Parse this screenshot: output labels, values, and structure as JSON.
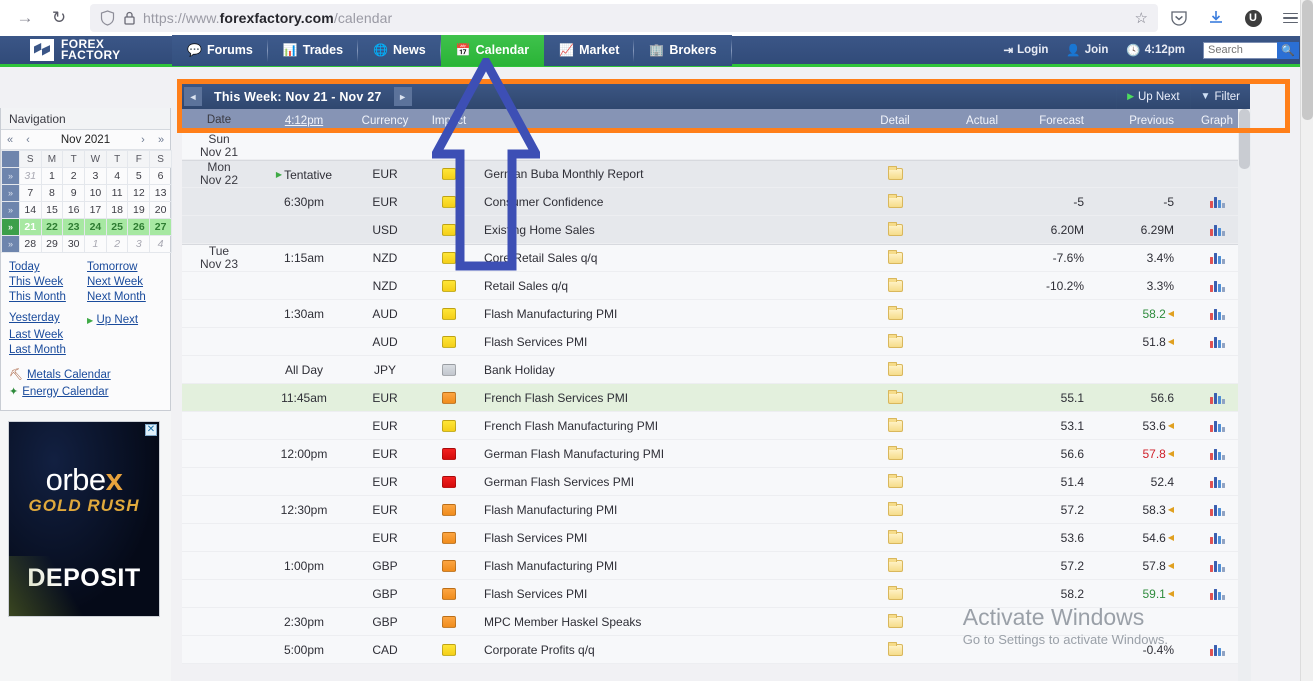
{
  "browser": {
    "url_prefix": "https://www.",
    "url_domain": "forexfactory.com",
    "url_path": "/calendar",
    "forward_icon": "forward-arrow-icon",
    "reload_icon": "reload-icon",
    "shield_icon": "shield-icon",
    "lock_icon": "padlock-icon",
    "star_icon": "bookmark-star-icon",
    "pocket_icon": "pocket-icon",
    "download_icon": "download-icon",
    "ublock_label": "U",
    "menu_icon": "hamburger-menu-icon"
  },
  "site": {
    "logo_line1": "FOREX",
    "logo_line2": "FACTORY",
    "tabs": [
      {
        "label": "Forums",
        "icon": "speech-bubble-icon",
        "glyph": "💬",
        "active": false
      },
      {
        "label": "Trades",
        "icon": "bar-chart-icon",
        "glyph": "📊",
        "active": false
      },
      {
        "label": "News",
        "icon": "globe-icon",
        "glyph": "🌐",
        "active": false
      },
      {
        "label": "Calendar",
        "icon": "calendar-icon",
        "glyph": "📅",
        "active": true
      },
      {
        "label": "Market",
        "icon": "trend-chart-icon",
        "glyph": "📈",
        "active": false
      },
      {
        "label": "Brokers",
        "icon": "building-icon",
        "glyph": "🏢",
        "active": false
      }
    ],
    "login_label": "Login",
    "join_label": "Join",
    "clock_time": "4:12pm",
    "search_placeholder": "Search",
    "search_value": "",
    "accent_green": "#2fc43a",
    "header_blue": "#3b5687"
  },
  "sidebar": {
    "title": "Navigation",
    "month_label": "Nov 2021",
    "nav_first": "«",
    "nav_prev": "‹",
    "nav_next": "›",
    "nav_last": "»",
    "dow": [
      "S",
      "M",
      "T",
      "W",
      "T",
      "F",
      "S"
    ],
    "weeks": [
      {
        "days": [
          "31",
          "1",
          "2",
          "3",
          "4",
          "5",
          "6"
        ],
        "off": [
          true,
          false,
          false,
          false,
          false,
          false,
          false
        ],
        "selected": false
      },
      {
        "days": [
          "7",
          "8",
          "9",
          "10",
          "11",
          "12",
          "13"
        ],
        "off": [
          false,
          false,
          false,
          false,
          false,
          false,
          false
        ],
        "selected": false
      },
      {
        "days": [
          "14",
          "15",
          "16",
          "17",
          "18",
          "19",
          "20"
        ],
        "off": [
          false,
          false,
          false,
          false,
          false,
          false,
          false
        ],
        "selected": false
      },
      {
        "days": [
          "21",
          "22",
          "23",
          "24",
          "25",
          "26",
          "27"
        ],
        "off": [
          false,
          false,
          false,
          false,
          false,
          false,
          false
        ],
        "selected": true
      },
      {
        "days": [
          "28",
          "29",
          "30",
          "1",
          "2",
          "3",
          "4"
        ],
        "off": [
          false,
          false,
          false,
          true,
          true,
          true,
          true
        ],
        "selected": false
      }
    ],
    "links": [
      "Today",
      "Tomorrow",
      "This Week",
      "Next Week",
      "This Month",
      "Next Month"
    ],
    "links2": [
      "Yesterday",
      "Up Next",
      "Last Week",
      "",
      "Last Month",
      ""
    ],
    "metals_label": "Metals Calendar",
    "energy_label": "Energy Calendar",
    "ad": {
      "brand_a": "orbe",
      "brand_x": "x",
      "tagline": "GOLD RUSH",
      "cta": "DEPOSIT",
      "close_label": "✕"
    }
  },
  "calendar": {
    "week_title": "This Week: Nov 21 - Nov 27",
    "prev_arrow": "◄",
    "next_arrow": "►",
    "up_next_label": "Up Next",
    "filter_label": "Filter",
    "columns": {
      "date": "Date",
      "time": "4:12pm",
      "currency": "Currency",
      "impact": "Impact",
      "detail": "Detail",
      "actual": "Actual",
      "forecast": "Forecast",
      "previous": "Previous",
      "graph": "Graph"
    },
    "rows": [
      {
        "date": [
          "Sun",
          "Nov 21"
        ],
        "time": "",
        "currency": "",
        "impact": "",
        "event": "",
        "detail": false,
        "actual": "",
        "forecast": "",
        "previous": "",
        "graph": false,
        "shade": "light",
        "daystart": true
      },
      {
        "date": [
          "Mon",
          "Nov 22"
        ],
        "time": "Tentative",
        "tentative": true,
        "currency": "EUR",
        "impact": "yellow",
        "event": "German Buba Monthly Report",
        "detail": true,
        "actual": "",
        "forecast": "",
        "previous": "",
        "graph": false,
        "shade": "shade",
        "daystart": true
      },
      {
        "date": [
          "",
          ""
        ],
        "time": "6:30pm",
        "currency": "EUR",
        "impact": "yellow",
        "event": "Consumer Confidence",
        "detail": true,
        "actual": "",
        "forecast": "-5",
        "previous": "-5",
        "graph": true,
        "shade": "shade"
      },
      {
        "date": [
          "",
          ""
        ],
        "time": "",
        "currency": "USD",
        "impact": "yellow",
        "event": "Existing Home Sales",
        "detail": true,
        "actual": "",
        "forecast": "6.20M",
        "previous": "6.29M",
        "graph": true,
        "shade": "shade"
      },
      {
        "date": [
          "Tue",
          "Nov 23"
        ],
        "time": "1:15am",
        "currency": "NZD",
        "impact": "yellow",
        "event": "Core Retail Sales q/q",
        "detail": true,
        "actual": "",
        "forecast": "-7.6%",
        "previous": "3.4%",
        "graph": true,
        "shade": "light",
        "daystart": true
      },
      {
        "date": [
          "",
          ""
        ],
        "time": "",
        "currency": "NZD",
        "impact": "yellow",
        "event": "Retail Sales q/q",
        "detail": true,
        "actual": "",
        "forecast": "-10.2%",
        "previous": "3.3%",
        "graph": true,
        "shade": "light"
      },
      {
        "date": [
          "",
          ""
        ],
        "time": "1:30am",
        "currency": "AUD",
        "impact": "yellow",
        "event": "Flash Manufacturing PMI",
        "detail": true,
        "actual": "",
        "forecast": "",
        "previous": "58.2",
        "previous_color": "green",
        "revised": true,
        "graph": true,
        "shade": "light"
      },
      {
        "date": [
          "",
          ""
        ],
        "time": "",
        "currency": "AUD",
        "impact": "yellow",
        "event": "Flash Services PMI",
        "detail": true,
        "actual": "",
        "forecast": "",
        "previous": "51.8",
        "revised": true,
        "graph": true,
        "shade": "light"
      },
      {
        "date": [
          "",
          ""
        ],
        "time": "All Day",
        "currency": "JPY",
        "impact": "gray",
        "event": "Bank Holiday",
        "detail": true,
        "actual": "",
        "forecast": "",
        "previous": "",
        "graph": false,
        "shade": "light"
      },
      {
        "date": [
          "",
          ""
        ],
        "time": "11:45am",
        "currency": "EUR",
        "impact": "orange",
        "event": "French Flash Services PMI",
        "detail": true,
        "actual": "",
        "forecast": "55.1",
        "previous": "56.6",
        "graph": true,
        "shade": "green"
      },
      {
        "date": [
          "",
          ""
        ],
        "time": "",
        "currency": "EUR",
        "impact": "yellow",
        "event": "French Flash Manufacturing PMI",
        "detail": true,
        "actual": "",
        "forecast": "53.1",
        "previous": "53.6",
        "revised": true,
        "graph": true,
        "shade": "light"
      },
      {
        "date": [
          "",
          ""
        ],
        "time": "12:00pm",
        "currency": "EUR",
        "impact": "red",
        "event": "German Flash Manufacturing PMI",
        "detail": true,
        "actual": "",
        "forecast": "56.6",
        "previous": "57.8",
        "previous_color": "red",
        "revised": true,
        "graph": true,
        "shade": "light"
      },
      {
        "date": [
          "",
          ""
        ],
        "time": "",
        "currency": "EUR",
        "impact": "red",
        "event": "German Flash Services PMI",
        "detail": true,
        "actual": "",
        "forecast": "51.4",
        "previous": "52.4",
        "graph": true,
        "shade": "light"
      },
      {
        "date": [
          "",
          ""
        ],
        "time": "12:30pm",
        "currency": "EUR",
        "impact": "orange",
        "event": "Flash Manufacturing PMI",
        "detail": true,
        "actual": "",
        "forecast": "57.2",
        "previous": "58.3",
        "revised": true,
        "graph": true,
        "shade": "light"
      },
      {
        "date": [
          "",
          ""
        ],
        "time": "",
        "currency": "EUR",
        "impact": "orange",
        "event": "Flash Services PMI",
        "detail": true,
        "actual": "",
        "forecast": "53.6",
        "previous": "54.6",
        "revised": true,
        "graph": true,
        "shade": "light"
      },
      {
        "date": [
          "",
          ""
        ],
        "time": "1:00pm",
        "currency": "GBP",
        "impact": "orange",
        "event": "Flash Manufacturing PMI",
        "detail": "multi",
        "actual": "",
        "forecast": "57.2",
        "previous": "57.8",
        "revised": true,
        "graph": true,
        "shade": "light"
      },
      {
        "date": [
          "",
          ""
        ],
        "time": "",
        "currency": "GBP",
        "impact": "orange",
        "event": "Flash Services PMI",
        "detail": "multi",
        "actual": "",
        "forecast": "58.2",
        "previous": "59.1",
        "previous_color": "green",
        "revised": true,
        "graph": true,
        "shade": "light"
      },
      {
        "date": [
          "",
          ""
        ],
        "time": "2:30pm",
        "currency": "GBP",
        "impact": "orange",
        "event": "MPC Member Haskel Speaks",
        "detail": true,
        "actual": "",
        "forecast": "",
        "previous": "",
        "graph": false,
        "shade": "light"
      },
      {
        "date": [
          "",
          ""
        ],
        "time": "5:00pm",
        "currency": "CAD",
        "impact": "yellow",
        "event": "Corporate Profits q/q",
        "detail": true,
        "actual": "",
        "forecast": "",
        "previous": "-0.4%",
        "graph": true,
        "shade": "light"
      }
    ]
  },
  "watermark": {
    "line1": "Activate Windows",
    "line2": "Go to Settings to activate Windows."
  },
  "annotation": {
    "box_color": "#ff7f19",
    "arrow_color": "#3d4fb5"
  }
}
